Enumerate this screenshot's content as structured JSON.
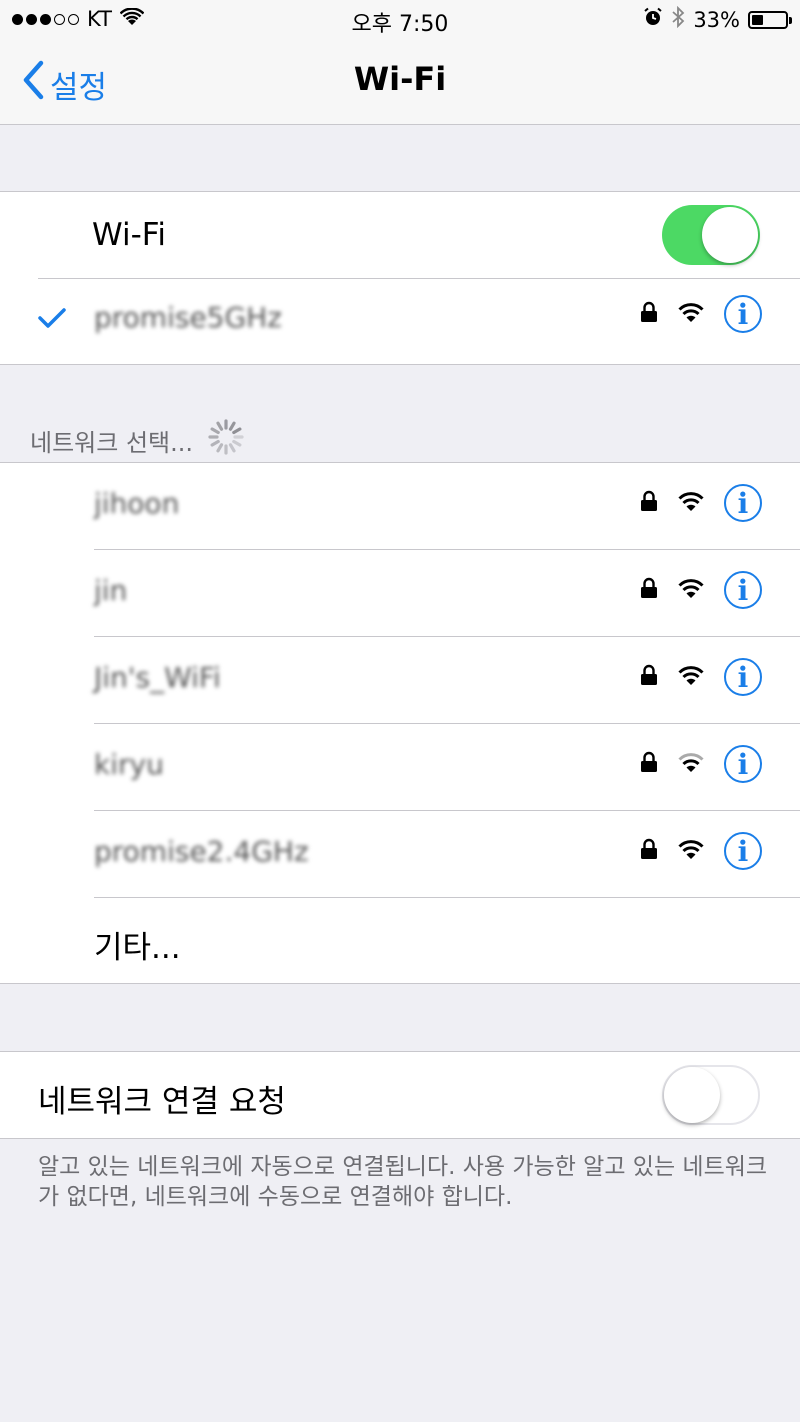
{
  "status_bar": {
    "carrier": "KT",
    "time": "오후 7:50",
    "battery_percent": "33%",
    "battery_level": 0.33
  },
  "nav": {
    "back_label": "설정",
    "title": "Wi-Fi"
  },
  "wifi_toggle": {
    "label": "Wi-Fi",
    "on": true
  },
  "connected_network": {
    "name": "promise5GHz"
  },
  "section_header": "네트워크 선택...",
  "networks": [
    {
      "name": "jihoon",
      "signal": "full"
    },
    {
      "name": "jin",
      "signal": "full"
    },
    {
      "name": "Jin's_WiFi",
      "signal": "full"
    },
    {
      "name": "kiryu",
      "signal": "weak"
    },
    {
      "name": "promise2.4GHz",
      "signal": "full"
    }
  ],
  "other_label": "기타...",
  "ask_to_join": {
    "label": "네트워크 연결 요청",
    "on": false
  },
  "footer_text": "알고 있는 네트워크에 자동으로 연결됩니다. 사용 가능한 알고 있는 네트워크가 없다면, 네트워크에 수동으로 연결해야 합니다.",
  "colors": {
    "accent": "#1a7ee8",
    "toggle_on": "#4cd964"
  },
  "icons": {
    "lock": "lock-icon",
    "wifi": "wifi-signal-icon",
    "info": "info-icon"
  }
}
